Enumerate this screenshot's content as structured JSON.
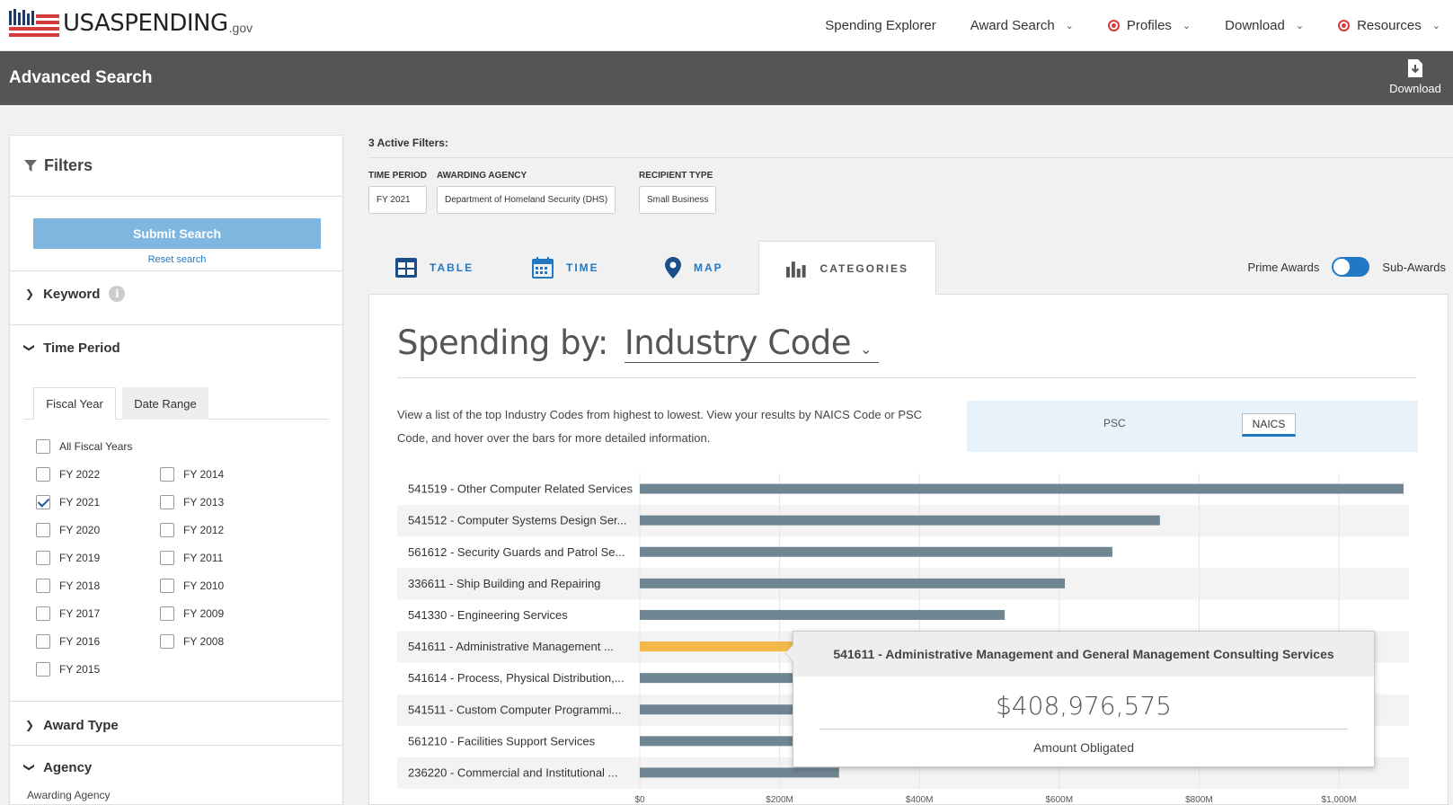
{
  "site": {
    "logo_main": "USASPENDING",
    "logo_suffix": ".gov"
  },
  "nav": {
    "items": [
      {
        "label": "Spending Explorer",
        "dropdown": false,
        "dot": false
      },
      {
        "label": "Award Search",
        "dropdown": true,
        "dot": false
      },
      {
        "label": "Profiles",
        "dropdown": true,
        "dot": true
      },
      {
        "label": "Download",
        "dropdown": true,
        "dot": false
      },
      {
        "label": "Resources",
        "dropdown": true,
        "dot": true
      }
    ]
  },
  "header": {
    "title": "Advanced Search",
    "download_label": "Download"
  },
  "sidebar": {
    "title": "Filters",
    "submit_label": "Submit Search",
    "reset_label": "Reset search",
    "keyword_label": "Keyword",
    "time_period_label": "Time Period",
    "tab_fiscal_year": "Fiscal Year",
    "tab_date_range": "Date Range",
    "all_fiscal_years": "All Fiscal Years",
    "fiscal_years_left": [
      {
        "label": "FY 2022",
        "checked": false
      },
      {
        "label": "FY 2021",
        "checked": true
      },
      {
        "label": "FY 2020",
        "checked": false
      },
      {
        "label": "FY 2019",
        "checked": false
      },
      {
        "label": "FY 2018",
        "checked": false
      },
      {
        "label": "FY 2017",
        "checked": false
      },
      {
        "label": "FY 2016",
        "checked": false
      },
      {
        "label": "FY 2015",
        "checked": false
      }
    ],
    "fiscal_years_right": [
      {
        "label": "FY 2014",
        "checked": false
      },
      {
        "label": "FY 2013",
        "checked": false
      },
      {
        "label": "FY 2012",
        "checked": false
      },
      {
        "label": "FY 2011",
        "checked": false
      },
      {
        "label": "FY 2010",
        "checked": false
      },
      {
        "label": "FY 2009",
        "checked": false
      },
      {
        "label": "FY 2008",
        "checked": false
      }
    ],
    "award_type_label": "Award Type",
    "agency_label": "Agency",
    "awarding_agency_label": "Awarding Agency"
  },
  "active_filters": {
    "label": "3 Active Filters:",
    "groups": [
      {
        "title": "Time Period",
        "chip": "FY 2021"
      },
      {
        "title": "Awarding Agency",
        "chip": "Department of Homeland Security (DHS)"
      },
      {
        "title": "Recipient Type",
        "chip": "Small Business"
      }
    ]
  },
  "viz_tabs": {
    "table": "TABLE",
    "time": "TIME",
    "map": "MAP",
    "categories": "CATEGORIES",
    "active": "CATEGORIES"
  },
  "award_toggle": {
    "left": "Prime Awards",
    "right": "Sub-Awards"
  },
  "spending": {
    "prefix": "Spending by:",
    "selected": "Industry Code",
    "description": "View a list of the top Industry Codes from highest to lowest. View your results by NAICS Code or PSC Code, and hover over the bars for more detailed information.",
    "type_psc": "PSC",
    "type_naics": "NAICS",
    "type_selected": "NAICS"
  },
  "colors": {
    "bar": "#6f8592",
    "bar_highlight": "#f2b94a",
    "accent": "#2378c3"
  },
  "chart_data": {
    "type": "bar",
    "orientation": "horizontal",
    "categories": [
      "541519 - Other Computer Related Services",
      "541512 - Computer Systems Design Ser...",
      "561612 - Security Guards and Patrol Se...",
      "336611 - Ship Building and Repairing",
      "541330 - Engineering Services",
      "541611 - Administrative Management ...",
      "541614 - Process, Physical Distribution,...",
      "541511 - Custom Computer Programmi...",
      "561210 - Facilities Support Services",
      "236220 - Commercial and Institutional ..."
    ],
    "values": [
      1093000000,
      744000000,
      676000000,
      608000000,
      522000000,
      408976575,
      380000000,
      350000000,
      310000000,
      285000000
    ],
    "highlighted_index": 5,
    "xlim": [
      0,
      1100000000
    ],
    "x_ticks": [
      0,
      200000000,
      400000000,
      600000000,
      800000000,
      1000000000
    ],
    "x_tick_labels": [
      "$0",
      "$200M",
      "$400M",
      "$600M",
      "$800M",
      "$1,000M"
    ],
    "grid": true
  },
  "tooltip": {
    "title": "541611 - Administrative Management and General Management Consulting Services",
    "amount": "$408,976,575",
    "label": "Amount Obligated"
  }
}
